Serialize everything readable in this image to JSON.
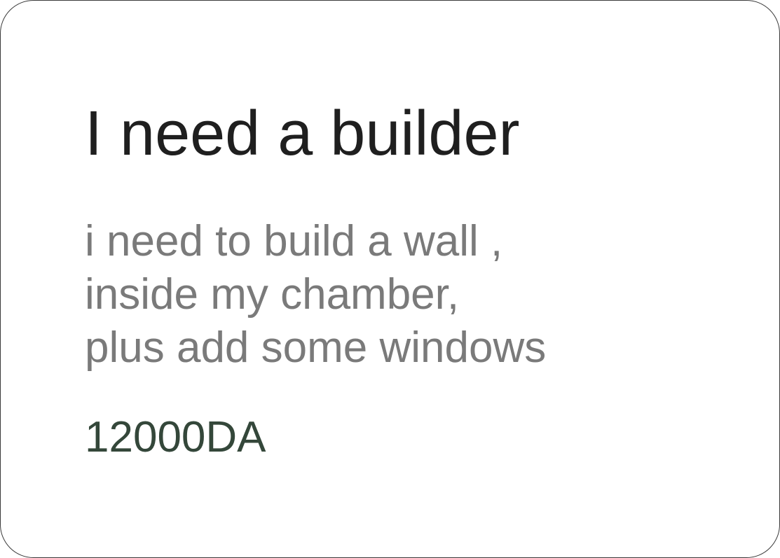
{
  "card": {
    "title": "I need a builder",
    "description_lines": [
      "i need to build a wall ,",
      "inside my chamber,",
      "plus add some windows"
    ],
    "price": "12000DA"
  },
  "colors": {
    "title": "#1f1f1f",
    "description": "#7a7a7a",
    "price": "#34473a",
    "border": "#3a3a3a",
    "background": "#ffffff"
  }
}
